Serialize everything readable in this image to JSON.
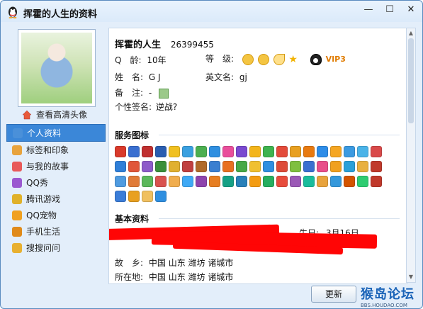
{
  "window": {
    "title": "挥霍的人生的资料"
  },
  "window_buttons": {
    "min": "—",
    "max": "☐",
    "close": "✕"
  },
  "sidebar": {
    "hd_link": "查看高清头像",
    "items": [
      {
        "label": "个人资料",
        "icon": "profile-icon",
        "color": "#4a90d9",
        "active": true
      },
      {
        "label": "标签和印象",
        "icon": "tag-icon",
        "color": "#e8a33d"
      },
      {
        "label": "与我的故事",
        "icon": "rainbow-icon",
        "color": "#e85a5a"
      },
      {
        "label": "QQ秀",
        "icon": "qqshow-icon",
        "color": "#9b59d0"
      },
      {
        "label": "腾讯游戏",
        "icon": "game-icon",
        "color": "#e0b12a"
      },
      {
        "label": "QQ宠物",
        "icon": "pet-icon",
        "color": "#f0a020"
      },
      {
        "label": "手机生活",
        "icon": "phone-check-icon",
        "color": "#e08a1a"
      },
      {
        "label": "搜搜问问",
        "icon": "question-icon",
        "color": "#e8b030"
      }
    ]
  },
  "profile": {
    "nickname": "挥霍的人生",
    "qq_number": "26399455",
    "age_label": "Q　龄:",
    "age_value": "10年",
    "level_label": "等　级:",
    "name_label": "姓　名:",
    "name_value": "G J",
    "en_name_label": "英文名:",
    "en_name_value": "gj",
    "note_label": "备　注:",
    "note_value": "-",
    "signature_label": "个性签名:",
    "signature_value": "逆战?",
    "vip_text": "VIP3"
  },
  "services": {
    "title": "服务图标",
    "rows": [
      [
        "#d93a2b",
        "#3a6fd0",
        "#c03030",
        "#2a5db0",
        "#f0c020",
        "#3aa0e0",
        "#4caf50",
        "#2f8fe0",
        "#e94e9b",
        "#7a4ad0",
        "#f3b51b",
        "#3fb34f",
        "#e34b3a",
        "#e8a020",
        "#e87a10",
        "#2e8de8",
        "#f5a623",
        "#3b9ae1",
        "#4ab3e8",
        "#d94a4a"
      ],
      [
        "#2f7fd8",
        "#e0563a",
        "#8d5cc9",
        "#3a8f3a",
        "#e0b030",
        "#c04040",
        "#b06a2a",
        "#3a7fd0",
        "#e87020",
        "#47a847",
        "#f0c030",
        "#2f8fe0",
        "#dd4b39",
        "#7fbf3f",
        "#3a6fd0",
        "#e84e8a",
        "#f0a020",
        "#2aa0d8",
        "#e8b040",
        "#c0392b"
      ],
      [
        "#4f9be0",
        "#e07b39",
        "#5cb85c",
        "#d9534f",
        "#f0ad4e",
        "#3fa9f5",
        "#8e44ad",
        "#e67e22",
        "#16a085",
        "#2980b9",
        "#f39c12",
        "#27ae60",
        "#e74c3c",
        "#9b59b6",
        "#1abc9c",
        "#e8a33d",
        "#3498db",
        "#d35400",
        "#2ecc71",
        "#c0392b"
      ],
      [
        "#3b7dd8",
        "#e8a020",
        "#f0c060",
        "#2f8fe0"
      ]
    ]
  },
  "basic": {
    "title": "基本资料",
    "birthday_label": "生日:",
    "birthday_value": "3月16日",
    "hometown_label": "故　乡:",
    "hometown_value": "中国 山东 潍坊 诸城市",
    "location_label": "所在地:",
    "location_value": "中国 山东 潍坊 诸城市"
  },
  "footer": {
    "refresh": "更新",
    "watermark": "猴岛论坛",
    "watermark_sub": "BBS.HOUDAO.COM"
  }
}
